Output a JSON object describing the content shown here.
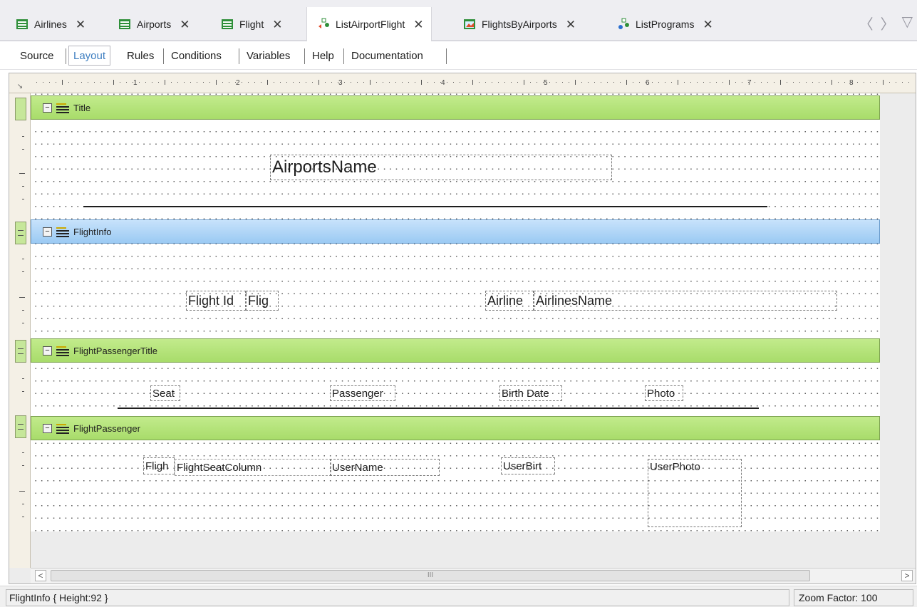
{
  "tabs": [
    {
      "label": "Airlines",
      "icon": "transaction-icon",
      "active": false
    },
    {
      "label": "Airports",
      "icon": "transaction-icon",
      "active": false
    },
    {
      "label": "Flight",
      "icon": "transaction-icon",
      "active": false
    },
    {
      "label": "ListAirportFlight",
      "icon": "procedure-icon",
      "active": true
    },
    {
      "label": "FlightsByAirports",
      "icon": "webpanel-icon",
      "active": false
    },
    {
      "label": "ListPrograms",
      "icon": "procedure-icon",
      "active": false
    }
  ],
  "tab_close_glyph": "✕",
  "nav": {
    "back": "〈",
    "forward": "〉",
    "dropdown": "▽"
  },
  "sections": [
    "Source",
    "Layout",
    "Rules",
    "Conditions",
    "Variables",
    "Help",
    "Documentation"
  ],
  "active_section": "Layout",
  "ruler_numbers": [
    "1",
    "2",
    "3",
    "4",
    "5",
    "6",
    "7",
    "8"
  ],
  "bands": {
    "title": {
      "name": "Title",
      "toggle": "−"
    },
    "flightinfo": {
      "name": "FlightInfo",
      "toggle": "−"
    },
    "passenger_title": {
      "name": "FlightPassengerTitle",
      "toggle": "−"
    },
    "passenger": {
      "name": "FlightPassenger",
      "toggle": "−"
    }
  },
  "controls": {
    "airports_name": "AirportsName",
    "flight_id_label": "Flight Id",
    "flight_id_value": "Flig",
    "airline_label": "Airline",
    "airlines_name": "AirlinesName",
    "seat_header": "Seat",
    "passenger_header": "Passenger",
    "birthdate_header": "Birth Date",
    "photo_header": "Photo",
    "flight_seat_short": "Fligh",
    "flight_seat_column": "FlightSeatColumn",
    "user_name": "UserName",
    "user_birth": "UserBirt",
    "user_photo": "UserPhoto"
  },
  "scrollbar": {
    "left": "<",
    "right": ">",
    "thumb_grip": "III"
  },
  "status": {
    "left": "FlightInfo { Height:92 }",
    "right": "Zoom Factor: 100"
  },
  "colors": {
    "band_green": "#b2e27a",
    "band_blue": "#a9d2f6",
    "active_tab_text": "#3c7dc0"
  }
}
